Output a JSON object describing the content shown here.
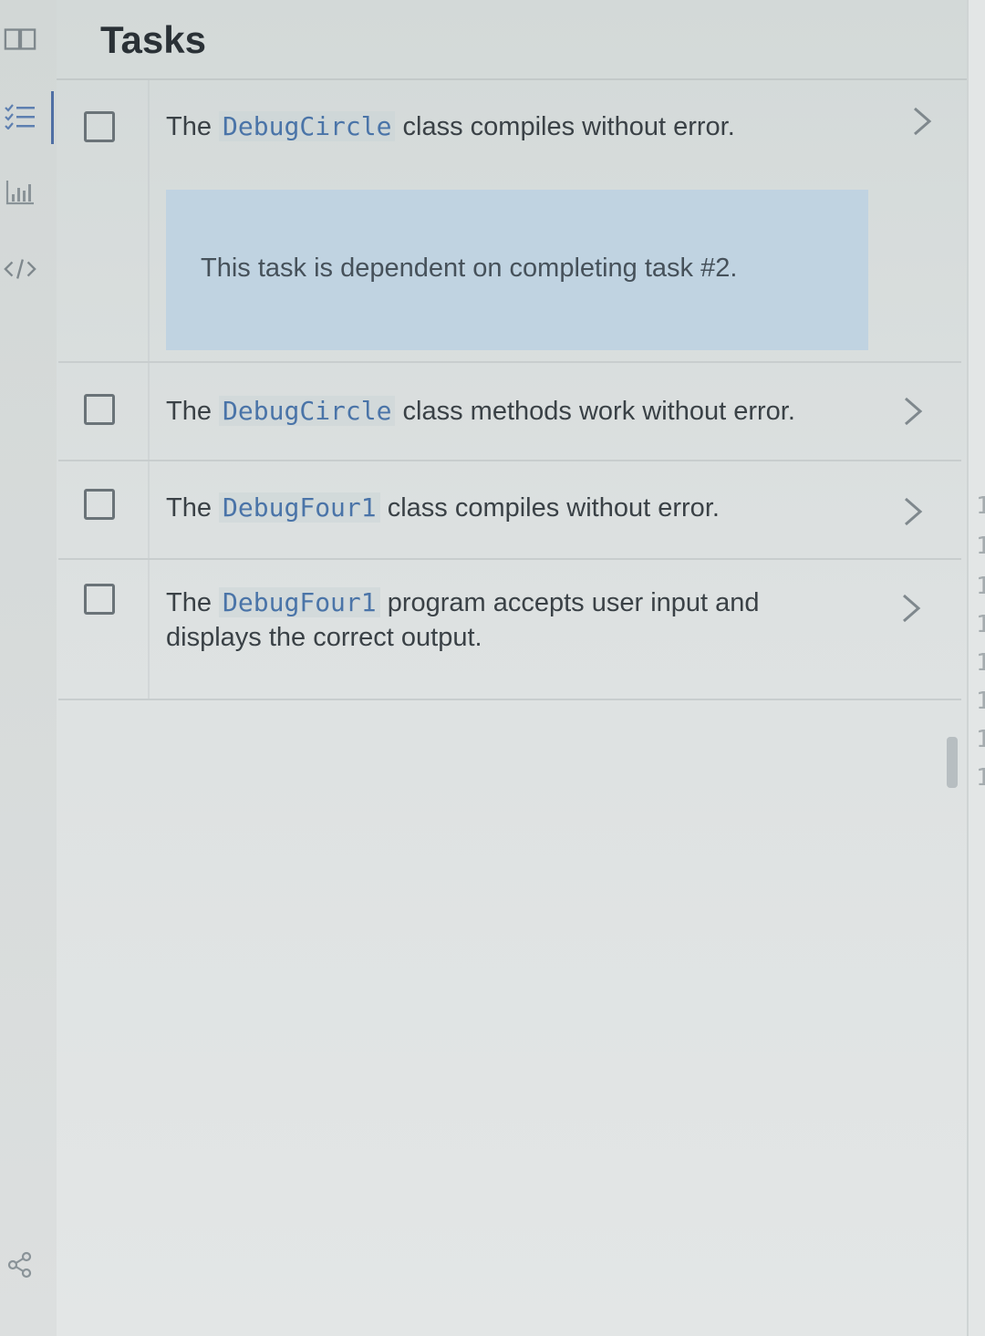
{
  "header": {
    "title": "Tasks"
  },
  "rail": {
    "icons": [
      "book-icon",
      "task-list-icon",
      "bar-chart-icon",
      "code-icon",
      "share-icon"
    ]
  },
  "tasks": [
    {
      "prefix": "The",
      "code": "DebugCircle",
      "suffix": "class compiles without error.",
      "checked": false,
      "dependency": "This task is dependent on completing task #2."
    },
    {
      "prefix": "The",
      "code": "DebugCircle",
      "suffix": "class methods work without error.",
      "checked": false
    },
    {
      "prefix": "The",
      "code": "DebugFour1",
      "suffix": "class compiles without error.",
      "checked": false
    },
    {
      "prefix": "The",
      "code": "DebugFour1",
      "suffix": "program accepts user input and displays the correct output.",
      "checked": false
    }
  ],
  "right_strip": {
    "line_numbers": [
      "1",
      "1",
      "1",
      "1",
      "1",
      "1",
      "1",
      "1"
    ]
  }
}
